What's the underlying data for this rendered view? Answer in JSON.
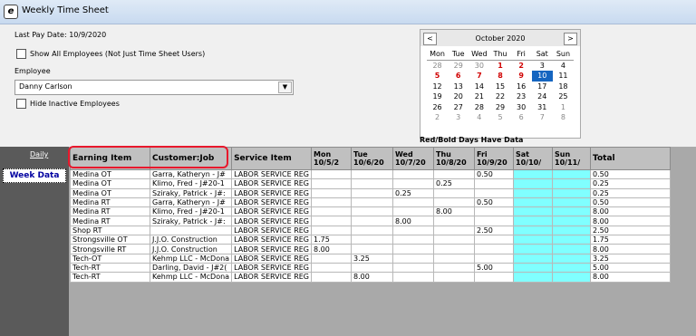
{
  "window": {
    "title": "Weekly Time Sheet",
    "icon": "app-icon"
  },
  "last_pay_date": "Last Pay Date: 10/9/2020",
  "show_all_label": "Show All Employees (Not Just Time Sheet Users)",
  "employee_label": "Employee",
  "employee_value": "Danny Carlson",
  "hide_inactive_label": "Hide Inactive Employees",
  "calendar": {
    "month": "October 2020",
    "prev": "<",
    "next": ">",
    "dow": [
      "Mon",
      "Tue",
      "Wed",
      "Thu",
      "Fri",
      "Sat",
      "Sun"
    ],
    "weeks": [
      [
        {
          "d": "28",
          "c": "other"
        },
        {
          "d": "29",
          "c": "other"
        },
        {
          "d": "30",
          "c": "other"
        },
        {
          "d": "1",
          "c": "red"
        },
        {
          "d": "2",
          "c": "red"
        },
        {
          "d": "3",
          "c": ""
        },
        {
          "d": "4",
          "c": ""
        }
      ],
      [
        {
          "d": "5",
          "c": "red"
        },
        {
          "d": "6",
          "c": "red"
        },
        {
          "d": "7",
          "c": "red"
        },
        {
          "d": "8",
          "c": "red"
        },
        {
          "d": "9",
          "c": "red"
        },
        {
          "d": "10",
          "c": "sel"
        },
        {
          "d": "11",
          "c": ""
        }
      ],
      [
        {
          "d": "12",
          "c": ""
        },
        {
          "d": "13",
          "c": ""
        },
        {
          "d": "14",
          "c": ""
        },
        {
          "d": "15",
          "c": ""
        },
        {
          "d": "16",
          "c": ""
        },
        {
          "d": "17",
          "c": ""
        },
        {
          "d": "18",
          "c": ""
        }
      ],
      [
        {
          "d": "19",
          "c": ""
        },
        {
          "d": "20",
          "c": ""
        },
        {
          "d": "21",
          "c": ""
        },
        {
          "d": "22",
          "c": ""
        },
        {
          "d": "23",
          "c": ""
        },
        {
          "d": "24",
          "c": ""
        },
        {
          "d": "25",
          "c": ""
        }
      ],
      [
        {
          "d": "26",
          "c": ""
        },
        {
          "d": "27",
          "c": ""
        },
        {
          "d": "28",
          "c": ""
        },
        {
          "d": "29",
          "c": ""
        },
        {
          "d": "30",
          "c": ""
        },
        {
          "d": "31",
          "c": ""
        },
        {
          "d": "1",
          "c": "other"
        }
      ],
      [
        {
          "d": "2",
          "c": "other"
        },
        {
          "d": "3",
          "c": "other"
        },
        {
          "d": "4",
          "c": "other"
        },
        {
          "d": "5",
          "c": "other"
        },
        {
          "d": "6",
          "c": "other"
        },
        {
          "d": "7",
          "c": "other"
        },
        {
          "d": "8",
          "c": "other"
        }
      ]
    ],
    "legend": "Red/Bold Days Have Data"
  },
  "nav": {
    "daily": "Daily",
    "week": "Week Data"
  },
  "grid": {
    "columns": [
      "Earning Item",
      "Customer:Job",
      "Service Item",
      "Mon\n10/5/2",
      "Tue\n10/6/20",
      "Wed\n10/7/20",
      "Thu\n10/8/20",
      "Fri\n10/9/20",
      "Sat\n10/10/",
      "Sun\n10/11/",
      "Total"
    ],
    "rows": [
      [
        "Medina OT",
        "Garra, Katheryn - J#",
        "LABOR SERVICE REG",
        "",
        "",
        "",
        "",
        "0.50",
        "",
        "",
        "0.50"
      ],
      [
        "Medina OT",
        "Klimo, Fred - J#20-1",
        "LABOR SERVICE REG",
        "",
        "",
        "",
        "0.25",
        "",
        "",
        "",
        "0.25"
      ],
      [
        "Medina OT",
        "Sziraky, Patrick - J#:",
        "LABOR SERVICE REG",
        "",
        "",
        "0.25",
        "",
        "",
        "",
        "",
        "0.25"
      ],
      [
        "Medina RT",
        "Garra, Katheryn - J#",
        "LABOR SERVICE REG",
        "",
        "",
        "",
        "",
        "0.50",
        "",
        "",
        "0.50"
      ],
      [
        "Medina RT",
        "Klimo, Fred - J#20-1",
        "LABOR SERVICE REG",
        "",
        "",
        "",
        "8.00",
        "",
        "",
        "",
        "8.00"
      ],
      [
        "Medina RT",
        "Sziraky, Patrick - J#:",
        "LABOR SERVICE REG",
        "",
        "",
        "8.00",
        "",
        "",
        "",
        "",
        "8.00"
      ],
      [
        "Shop RT",
        "",
        "LABOR SERVICE REG",
        "",
        "",
        "",
        "",
        "2.50",
        "",
        "",
        "2.50"
      ],
      [
        "Strongsville OT",
        "J.J.O. Construction",
        "LABOR SERVICE REG",
        "1.75",
        "",
        "",
        "",
        "",
        "",
        "",
        "1.75"
      ],
      [
        "Strongsville RT",
        "J.J.O. Construction",
        "LABOR SERVICE REG",
        "8.00",
        "",
        "",
        "",
        "",
        "",
        "",
        "8.00"
      ],
      [
        "Tech-OT",
        "Kehmp LLC - McDona",
        "LABOR SERVICE REG",
        "",
        "3.25",
        "",
        "",
        "",
        "",
        "",
        "3.25"
      ],
      [
        "Tech-RT",
        "Darling, David - J#2(",
        "LABOR SERVICE REG",
        "",
        "",
        "",
        "",
        "5.00",
        "",
        "",
        "5.00"
      ],
      [
        "Tech-RT",
        "Kehmp LLC - McDona",
        "LABOR SERVICE REG",
        "",
        "8.00",
        "",
        "",
        "",
        "",
        "",
        "8.00"
      ]
    ]
  }
}
